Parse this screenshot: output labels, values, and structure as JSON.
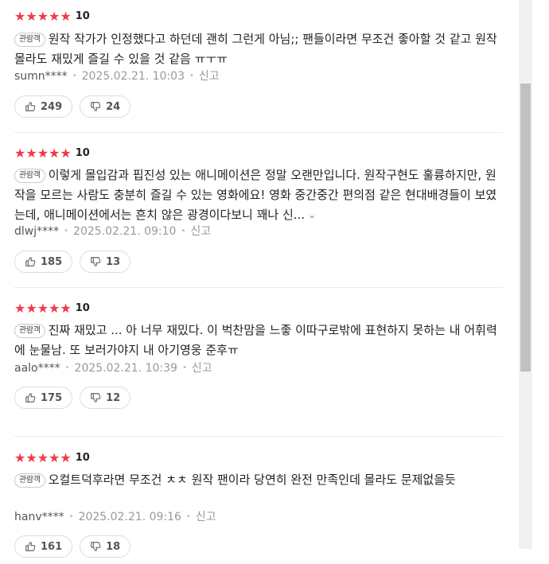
{
  "reviews": [
    {
      "stars": "★★★★★",
      "score": "10",
      "badge": "관람객",
      "text": "원작 작가가 인정했다고 하던데 괜히 그런게 아님;; 팬들이라면 무조건 좋아할 것 같고 원작 몰라도 재밌게 즐길 수 있을 것 같음 ㅠㅜㅠ",
      "user": "sumn****",
      "date": "2025.02.21. 10:03",
      "report": "신고",
      "likes": "249",
      "dislikes": "24"
    },
    {
      "stars": "★★★★★",
      "score": "10",
      "badge": "관람객",
      "text": "이렇게 몰입감과 핍진성 있는 애니메이션은 정말 오랜만입니다. 원작구현도 훌륭하지만, 원작을 모르는 사람도 충분히 즐길 수 있는 영화에요! 영화 중간중간 편의점 같은 현대배경들이 보였는데, 애니메이션에서는 흔치 않은 광경이다보니 꽤나 신...",
      "user": "dlwj****",
      "date": "2025.02.21. 09:10",
      "report": "신고",
      "likes": "185",
      "dislikes": "13"
    },
    {
      "stars": "★★★★★",
      "score": "10",
      "badge": "관람객",
      "text": "진짜 재밌고 ... 아 너무 재밌다. 이 벅찬맘을 느좋 이따구로밖에 표현하지 못하는 내 어휘력에 눈물남. 또 보러가야지 내 아기영웅 준후ㅠ",
      "user": "aalo****",
      "date": "2025.02.21. 10:39",
      "report": "신고",
      "likes": "175",
      "dislikes": "12"
    },
    {
      "stars": "★★★★★",
      "score": "10",
      "badge": "관람객",
      "text": "오컬트덕후라면 무조건 ㅊㅊ 원작 팬이라 당연히 완전 만족인데 몰라도 문제없을듯",
      "user": "hanv****",
      "date": "2025.02.21. 09:16",
      "report": "신고",
      "likes": "161",
      "dislikes": "18"
    }
  ],
  "icons": {
    "thumbs_up": "thumbs-up-icon",
    "thumbs_down": "thumbs-down-icon",
    "expand": "chevron-down-icon"
  },
  "colors": {
    "star": "#f03a4a"
  }
}
